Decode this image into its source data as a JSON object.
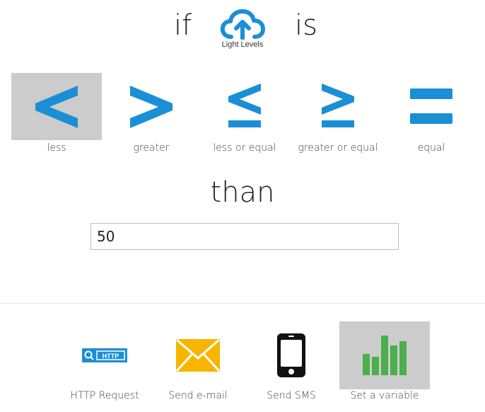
{
  "header": {
    "if_word": "if",
    "is_word": "is",
    "source": {
      "label": "Light Levels",
      "icon": "cloud-upload-icon",
      "color": "#1b8fd6"
    }
  },
  "operators": [
    {
      "symbol": "<",
      "label": "less",
      "icon": "less-than-icon",
      "selected": true
    },
    {
      "symbol": ">",
      "label": "greater",
      "icon": "greater-than-icon",
      "selected": false
    },
    {
      "symbol": "≤",
      "label": "less or equal",
      "icon": "less-or-equal-icon",
      "selected": false
    },
    {
      "symbol": "≥",
      "label": "greater or equal",
      "icon": "greater-or-equal-icon",
      "selected": false
    },
    {
      "symbol": "=",
      "label": "equal",
      "icon": "equal-icon",
      "selected": false
    }
  ],
  "than_word": "than",
  "threshold": {
    "value": "50"
  },
  "actions": [
    {
      "label": "HTTP Request",
      "icon": "http-request-icon",
      "icon_text": "HTTP",
      "selected": false
    },
    {
      "label": "Send e-mail",
      "icon": "envelope-icon",
      "selected": false
    },
    {
      "label": "Send SMS",
      "icon": "phone-icon",
      "selected": false
    },
    {
      "label": "Set a variable",
      "icon": "bar-chart-icon",
      "selected": true
    }
  ],
  "colors": {
    "accent": "#1b8fd6",
    "selected_bg": "#cccccc",
    "email": "#f7b500",
    "variable": "#4cae4c"
  }
}
